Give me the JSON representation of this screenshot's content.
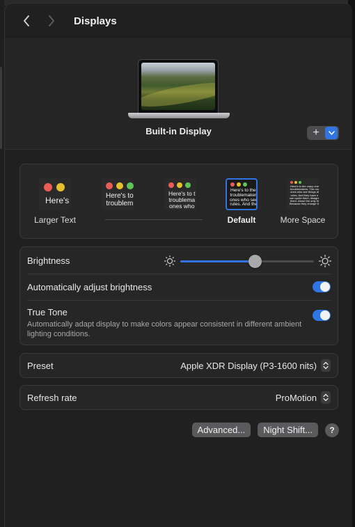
{
  "window": {
    "title": "Displays"
  },
  "display": {
    "name": "Built-in Display"
  },
  "add_control": {
    "plus": "+"
  },
  "resolution": {
    "options": [
      {
        "label": "Larger Text",
        "thumb_text": "Here's"
      },
      {
        "label": "",
        "thumb_text": "Here's to\ntroublem"
      },
      {
        "label": "",
        "thumb_text": "Here's to t\ntroublema\nones who"
      },
      {
        "label": "Default",
        "thumb_text": "Here's to the c\ntroublemakers.\nones who see t\nrules. And they"
      },
      {
        "label": "More Space",
        "thumb_text": "Here's to the crazy one\ntroublemakers. The rou\nones who see things di\nrules. And they have n\ncan quote them, disagre\nthem. About the only th\nBecause they change th"
      }
    ],
    "selected": "Default"
  },
  "brightness": {
    "label": "Brightness",
    "level": 0.56
  },
  "auto_brightness": {
    "label": "Automatically adjust brightness",
    "on": true
  },
  "true_tone": {
    "label": "True Tone",
    "description": "Automatically adapt display to make colors appear consistent in different ambient lighting conditions.",
    "on": true
  },
  "preset": {
    "label": "Preset",
    "value": "Apple XDR Display (P3-1600 nits)"
  },
  "refresh_rate": {
    "label": "Refresh rate",
    "value": "ProMotion"
  },
  "buttons": {
    "advanced": "Advanced...",
    "night_shift": "Night Shift...",
    "help": "?"
  },
  "colors": {
    "accent": "#2f76e3",
    "window_bg": "#202021",
    "group_bg": "#262627"
  }
}
